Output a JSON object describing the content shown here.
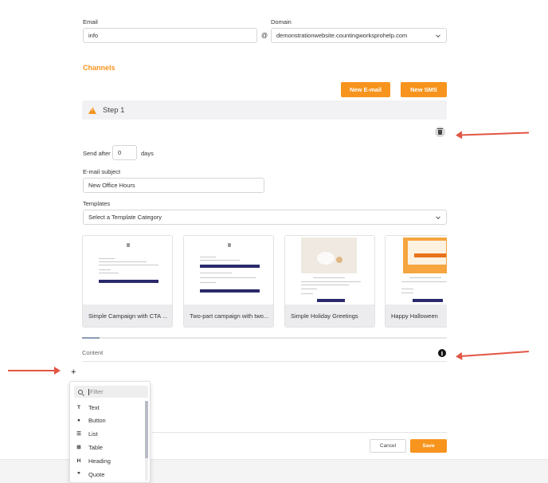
{
  "form": {
    "email_label": "Email",
    "email_value": "info",
    "at_sign": "@",
    "domain_label": "Domain",
    "domain_value": "demonstrationwebsite.countingworksprohelp.com"
  },
  "channels": {
    "title": "Channels",
    "new_email_label": "New E-mail",
    "new_sms_label": "New SMS"
  },
  "step": {
    "title": "Step 1",
    "send_after_label": "Send after",
    "send_after_value": "0",
    "days_label": "days",
    "subject_label": "E-mail subject",
    "subject_value": "New Office Hours",
    "templates_label": "Templates",
    "template_category_value": "Select a Template Category"
  },
  "templates": [
    {
      "name": "Simple Campaign with CTA ..."
    },
    {
      "name": "Two-part campaign with two..."
    },
    {
      "name": "Simple Holiday Greetings"
    },
    {
      "name": "Happy Halloween"
    }
  ],
  "content": {
    "label": "Content",
    "add_symbol": "+"
  },
  "block_menu": {
    "filter_placeholder": "Filter",
    "items": [
      {
        "label": "Text",
        "icon": "text-icon",
        "glyph": "T"
      },
      {
        "label": "Button",
        "icon": "button-icon",
        "glyph": "●"
      },
      {
        "label": "List",
        "icon": "list-icon",
        "glyph": "☰"
      },
      {
        "label": "Table",
        "icon": "table-icon",
        "glyph": "⊞"
      },
      {
        "label": "Heading",
        "icon": "heading-icon",
        "glyph": "H"
      },
      {
        "label": "Quote",
        "icon": "quote-icon",
        "glyph": "❞"
      }
    ]
  },
  "actions": {
    "cancel_label": "Cancel",
    "save_label": "Save"
  },
  "colors": {
    "accent": "#f7941d",
    "annotation_arrow": "#e25544",
    "template_button": "#2b2a6b"
  }
}
